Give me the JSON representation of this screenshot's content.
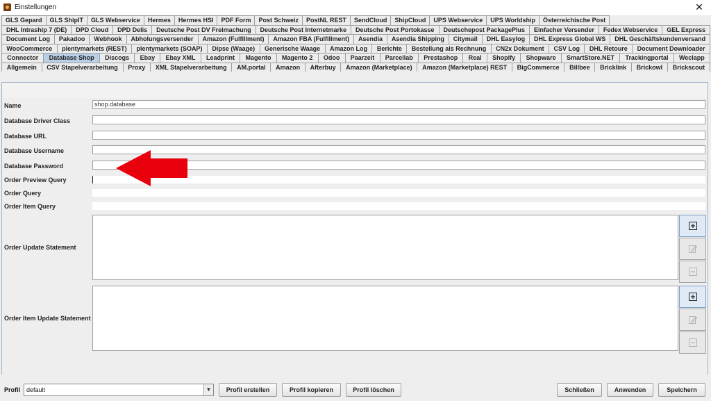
{
  "window": {
    "title": "Einstellungen",
    "close_glyph": "✕",
    "icon": "app-icon"
  },
  "tabs": {
    "rows": [
      [
        "GLS Gepard",
        "GLS ShipIT",
        "GLS Webservice",
        "Hermes",
        "Hermes HSI",
        "PDF Form",
        "Post Schweiz",
        "PostNL REST",
        "SendCloud",
        "ShipCloud",
        "UPS Webservice",
        "UPS Worldship",
        "Österreichische Post"
      ],
      [
        "DHL Intraship 7 (DE)",
        "DPD Cloud",
        "DPD Delis",
        "Deutsche Post DV Freimachung",
        "Deutsche Post Internetmarke",
        "Deutsche Post Portokasse",
        "Deutschepost PackagePlus",
        "Einfacher Versender",
        "Fedex Webservice",
        "GEL Express"
      ],
      [
        "Document Log",
        "Pakadoo",
        "Webhook",
        "Abholungsversender",
        "Amazon (Fulfillment)",
        "Amazon FBA (Fulfillment)",
        "Asendia",
        "Asendia Shipping",
        "Citymail",
        "DHL Easylog",
        "DHL Express Global WS",
        "DHL Geschäftskundenversand"
      ],
      [
        "WooCommerce",
        "plentymarkets (REST)",
        "plentymarkets (SOAP)",
        "Dipse (Waage)",
        "Generische Waage",
        "Amazon Log",
        "Berichte",
        "Bestellung als Rechnung",
        "CN2x Dokument",
        "CSV Log",
        "DHL Retoure",
        "Document Downloader"
      ],
      [
        "Connector",
        "Database Shop",
        "Discogs",
        "Ebay",
        "Ebay XML",
        "Leadprint",
        "Magento",
        "Magento 2",
        "Odoo",
        "Paarzeit",
        "Parcellab",
        "Prestashop",
        "Real",
        "Shopify",
        "Shopware",
        "SmartStore.NET",
        "Trackingportal",
        "Weclapp"
      ],
      [
        "Allgemein",
        "CSV Stapelverarbeitung",
        "Proxy",
        "XML Stapelverarbeitung",
        "AM.portal",
        "Amazon",
        "Afterbuy",
        "Amazon (Marketplace)",
        "Amazon (Marketplace) REST",
        "BigCommerce",
        "Billbee",
        "Bricklink",
        "Brickowl",
        "Brickscout"
      ]
    ],
    "selected": "Database Shop"
  },
  "form": {
    "name_label": "Name",
    "name_value": "shop.database",
    "driver_label": "Database Driver Class",
    "driver_value": "",
    "url_label": "Database URL",
    "url_value": "",
    "username_label": "Database Username",
    "username_value": "",
    "password_label": "Database Password",
    "password_value": "",
    "order_preview_label": "Order Preview Query",
    "order_query_label": "Order Query",
    "order_item_query_label": "Order Item Query",
    "order_update_label": "Order Update Statement",
    "order_item_update_label": "Order Item Update Statement"
  },
  "side_buttons": {
    "add_icon": "plus-square-icon",
    "edit_icon": "edit-icon",
    "remove_icon": "minus-square-icon"
  },
  "annotation": {
    "arrow_color": "#e8000d"
  },
  "footer": {
    "profil_label": "Profil",
    "profil_value": "default",
    "profil_erstellen": "Profil erstellen",
    "profil_kopieren": "Profil kopieren",
    "profil_loeschen": "Profil löschen",
    "schliessen": "Schließen",
    "anwenden": "Anwenden",
    "speichern": "Speichern"
  },
  "colors": {
    "selected_tab": "#b8cfe5",
    "window_bg": "#eeeeee"
  }
}
